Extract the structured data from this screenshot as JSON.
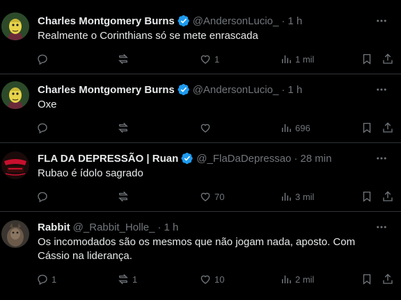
{
  "tweets": [
    {
      "name": "Charles Montgomery Burns",
      "handle": "@AndersonLucio_",
      "time": "1 h",
      "text": "Realmente o Corinthians só se mete enrascada",
      "replies": "",
      "retweets": "",
      "likes": "1",
      "views": "1 mil",
      "avatar_icon": "burns-avatar",
      "verified": true
    },
    {
      "name": "Charles Montgomery Burns",
      "handle": "@AndersonLucio_",
      "time": "1 h",
      "text": "Oxe",
      "replies": "",
      "retweets": "",
      "likes": "",
      "views": "696",
      "avatar_icon": "burns-avatar",
      "verified": true
    },
    {
      "name": "FLA DA DEPRESSÃO | Ruan",
      "handle": "@_FlaDaDepressao",
      "time": "28 min",
      "text": "Rubao é ídolo sagrado",
      "replies": "",
      "retweets": "",
      "likes": "70",
      "views": "3 mil",
      "avatar_icon": "fla-logo-avatar",
      "verified": true
    },
    {
      "name": "Rabbit",
      "handle": "@_Rabbit_Holle_",
      "time": "1 h",
      "text": "Os incomodados são os mesmos que não jogam nada, aposto. Com Cássio na liderança.",
      "replies": "1",
      "retweets": "1",
      "likes": "10",
      "views": "2 mil",
      "avatar_icon": "rabbit-avatar",
      "verified": false
    }
  ],
  "colors": {
    "background": "#000000",
    "text": "#e7e9ea",
    "muted": "#71767b",
    "verified": "#1d9bf0",
    "divider": "#2f3336"
  }
}
